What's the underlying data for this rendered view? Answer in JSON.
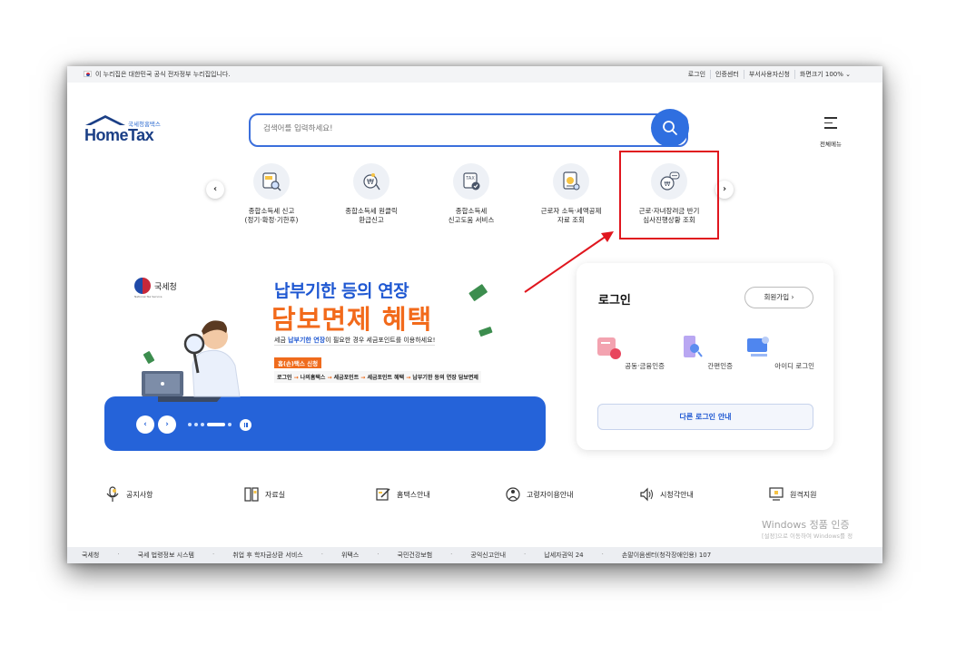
{
  "topbar": {
    "notice": "이 누리집은 대한민국 공식 전자정부 누리집입니다.",
    "links": [
      "로그인",
      "인증센터",
      "부서사용자신청",
      "화면크기 100% ⌄"
    ]
  },
  "header": {
    "logo_sub": "국세청홈택스",
    "logo_main": "HomeTax",
    "search_placeholder": "검색어를 입력하세요!",
    "menu_label": "전체메뉴"
  },
  "quick_menu": {
    "prev": "‹",
    "next": "›",
    "items": [
      {
        "line1": "종합소득세 신고",
        "line2": "(정기·확정·기한후)",
        "icon": "tax-document-search-icon"
      },
      {
        "line1": "종합소득세 원클릭",
        "line2": "환급신고",
        "icon": "won-click-icon"
      },
      {
        "line1": "종합소득세",
        "line2": "신고도움 서비스",
        "icon": "tax-check-icon"
      },
      {
        "line1": "근로자 소득·세액공제",
        "line2": "자료 조회",
        "icon": "won-document-search-icon"
      },
      {
        "line1": "근로·자녀장려금 반기",
        "line2": "심사진행상황 조회",
        "icon": "won-chat-icon"
      }
    ]
  },
  "banner": {
    "org": "국세청",
    "org_en": "National Tax Service",
    "title": "납부기한 등의 연장",
    "title2": "담보면제 혜택",
    "desc_pre": "세금 ",
    "desc_bold": "납부기한 연장",
    "desc_post": "이 필요한 경우 세금포인트를 이용하세요!",
    "tag": "홈(손)택스 신청",
    "steps": [
      "로그인",
      "나의홈택스",
      "세금포인트",
      "세금포인트 혜택",
      "납부기한 등의 연장 담보면제"
    ],
    "prev": "‹",
    "next": "›"
  },
  "login": {
    "title": "로그인",
    "join": "회원가입  ›",
    "options": [
      "공동·금융인증",
      "간편인증",
      "아이디 로그인"
    ],
    "other": "다른 로그인 안내"
  },
  "quick_links": [
    {
      "label": "공지사항",
      "icon": "microphone-icon"
    },
    {
      "label": "자료실",
      "icon": "folder-icon"
    },
    {
      "label": "홈택스안내",
      "icon": "guide-pen-icon"
    },
    {
      "label": "고령자이용안내",
      "icon": "elderly-icon"
    },
    {
      "label": "시청각안내",
      "icon": "speaker-icon"
    },
    {
      "label": "원격지원",
      "icon": "remote-monitor-icon"
    }
  ],
  "watermark": {
    "line1": "Windows 정품 인증",
    "line2": "[설정]으로 이동하여 Windows를 정"
  },
  "footer": {
    "items": [
      "국세청",
      "국세 법령정보 시스템",
      "취업 후 학자금상환 서비스",
      "위택스",
      "국민건강보험",
      "공익신고안내",
      "납세자권익 24",
      "손말이음센터(청각장애인용) 107"
    ]
  },
  "colors": {
    "primary": "#2f6fe0",
    "banner_blue": "#2563d9",
    "accent_orange": "#f26a1b",
    "highlight_red": "#e0161e"
  }
}
